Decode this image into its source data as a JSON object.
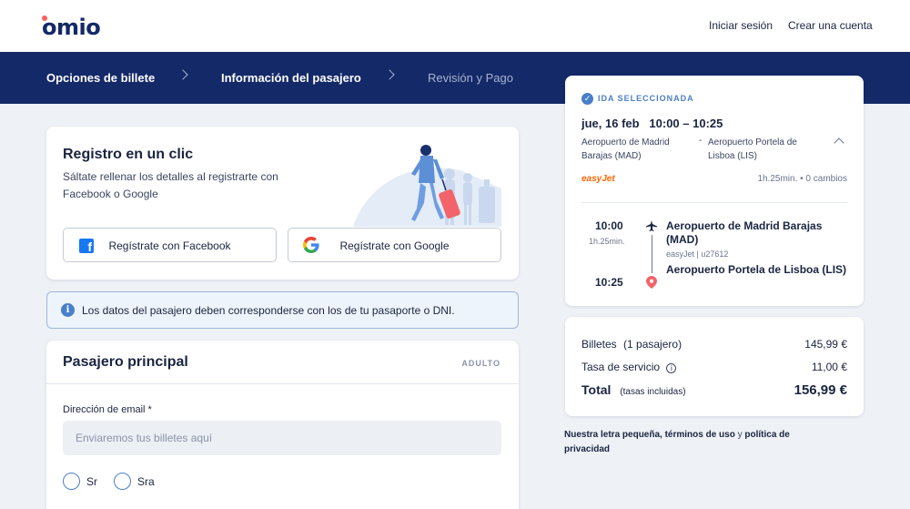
{
  "header": {
    "logo": "omio",
    "login": "Iniciar sesión",
    "signup": "Crear una cuenta"
  },
  "steps": [
    {
      "label": "Opciones de billete",
      "state": "done"
    },
    {
      "label": "Información del pasajero",
      "state": "current"
    },
    {
      "label": "Revisión y Pago",
      "state": "upcoming"
    }
  ],
  "registration": {
    "title": "Registro en un clic",
    "subtitle": "Sáltate rellenar los detalles al registrarte con Facebook o Google",
    "facebook_label": "Regístrate con Facebook",
    "google_label": "Regístrate con Google"
  },
  "notice": {
    "text": "Los datos del pasajero deben corresponderse con los de tu pasaporte o DNI."
  },
  "passenger": {
    "title": "Pasajero principal",
    "badge": "ADULTO",
    "email_label": "Dirección de email *",
    "email_placeholder": "Enviaremos tus billetes aquí",
    "email_value": "",
    "titles": [
      "Sr",
      "Sra"
    ]
  },
  "trip": {
    "selected_label": "IDA SELECCIONADA",
    "date_time": "jue, 16 feb   10:00 – 10:25",
    "from": "Aeropuerto de Madrid Barajas (MAD)",
    "to": "Aeropuerto Portela de Lisboa (LIS)",
    "carrier": "easyJet",
    "meta": "1h.25min. • 0 cambios",
    "departure_time": "10:00",
    "duration": "1h.25min.",
    "arrival_time": "10:25",
    "departure_airport": "Aeropuerto de Madrid Barajas (MAD)",
    "flight": "easyJet | u27612",
    "arrival_airport": "Aeropuerto Portela de Lisboa (LIS)"
  },
  "price": {
    "tickets_label": "Billetes",
    "tickets_sub": "(1 pasajero)",
    "tickets_value": "145,99 €",
    "service_label": "Tasa de servicio",
    "service_value": "11,00 €",
    "total_label": "Total",
    "total_sub": "(tasas incluidas)",
    "total_value": "156,99 €"
  },
  "fineprint": {
    "part1": "Nuestra letra pequeña, términos de uso",
    "and": " y ",
    "part2": "política de privacidad"
  },
  "colors": {
    "brand": "#132968",
    "accent": "#4a7fc9",
    "logo_dot": "#fc5e5e",
    "easyjet": "#ff6600"
  }
}
